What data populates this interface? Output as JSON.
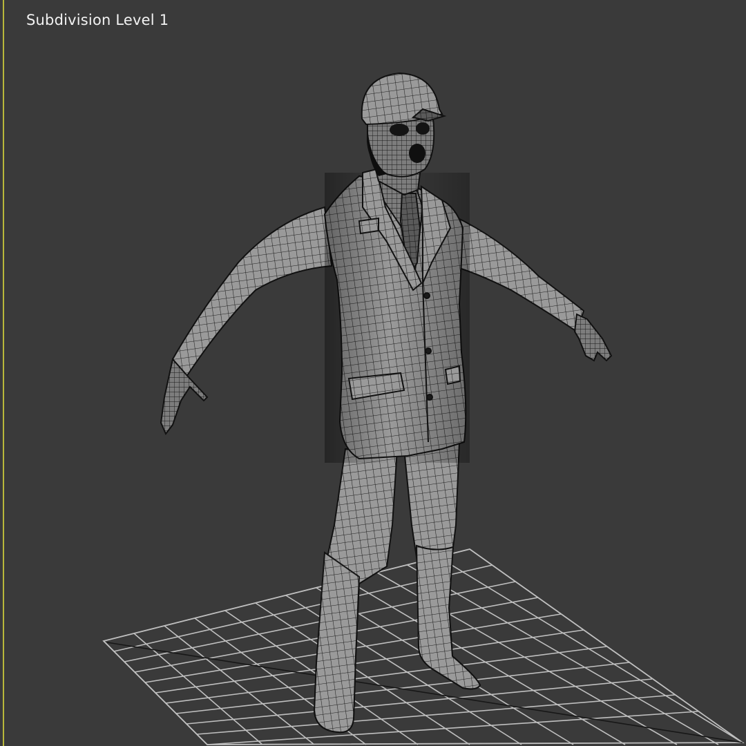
{
  "viewport": {
    "label": "Subdivision Level 1",
    "background": "#3a3a3a",
    "active_border_color": "#b9b83a"
  },
  "scene": {
    "model": "character-in-suit-with-cap",
    "shading": "wireframe-on-shaded",
    "ground_grid": true
  }
}
